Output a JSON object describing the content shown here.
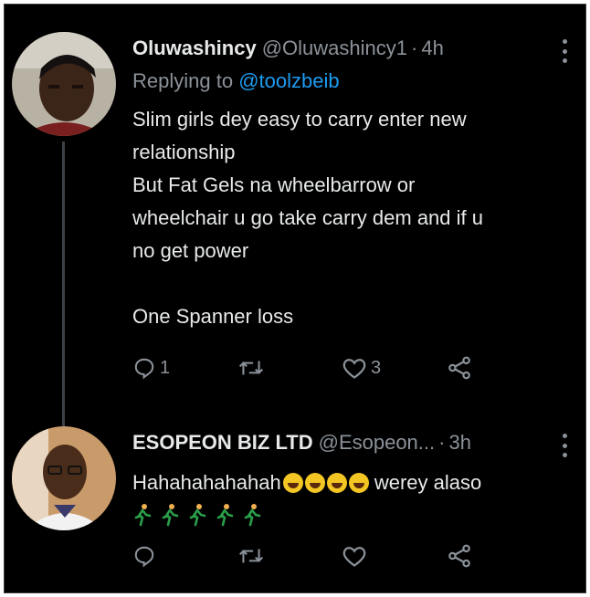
{
  "tweets": [
    {
      "display_name": "Oluwashincy",
      "handle": "@Oluwashincy1",
      "separator": "·",
      "time": "4h",
      "replying_prefix": "Replying to",
      "replying_to": "@toolzbeib",
      "lines": [
        "Slim girls dey easy to carry enter new",
        "relationship",
        "But Fat Gels na wheelbarrow or",
        "wheelchair u go take carry dem and if u",
        "no get power"
      ],
      "final_line": "One Spanner loss",
      "reply_count": "1",
      "retweet_count": "",
      "like_count": "3"
    },
    {
      "display_name": "ESOPEON BIZ LTD",
      "handle": "@Esopeon...",
      "separator": "·",
      "time": "3h",
      "text": "Hahahahahahah",
      "text_after_emoji": "werey alaso",
      "reply_count": "",
      "retweet_count": "",
      "like_count": ""
    }
  ],
  "icons": [
    "reply-icon",
    "retweet-icon",
    "like-icon",
    "share-icon",
    "more-icon",
    "laughing-emoji",
    "grinning-emoji",
    "runner-emoji"
  ],
  "colors": {
    "background": "#000000",
    "text": "#e7e9ea",
    "secondary": "#8b9299",
    "link": "#1d9bf0"
  }
}
